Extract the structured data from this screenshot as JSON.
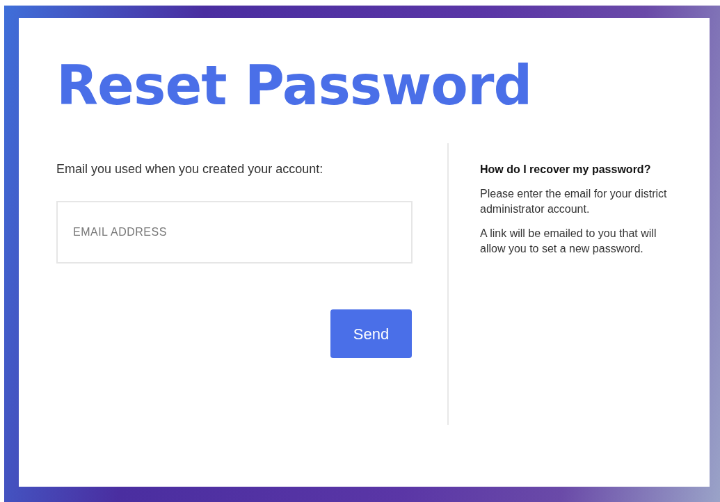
{
  "title": "Reset Password",
  "form": {
    "label": "Email you used when you created your account:",
    "email_field": {
      "placeholder": "EMAIL ADDRESS"
    },
    "send_button": "Send"
  },
  "help": {
    "heading": "How do I recover my password?",
    "paragraphs": [
      "Please enter the email for your district administrator account.",
      "A link will be emailed to you that will allow you to set a new password."
    ]
  }
}
